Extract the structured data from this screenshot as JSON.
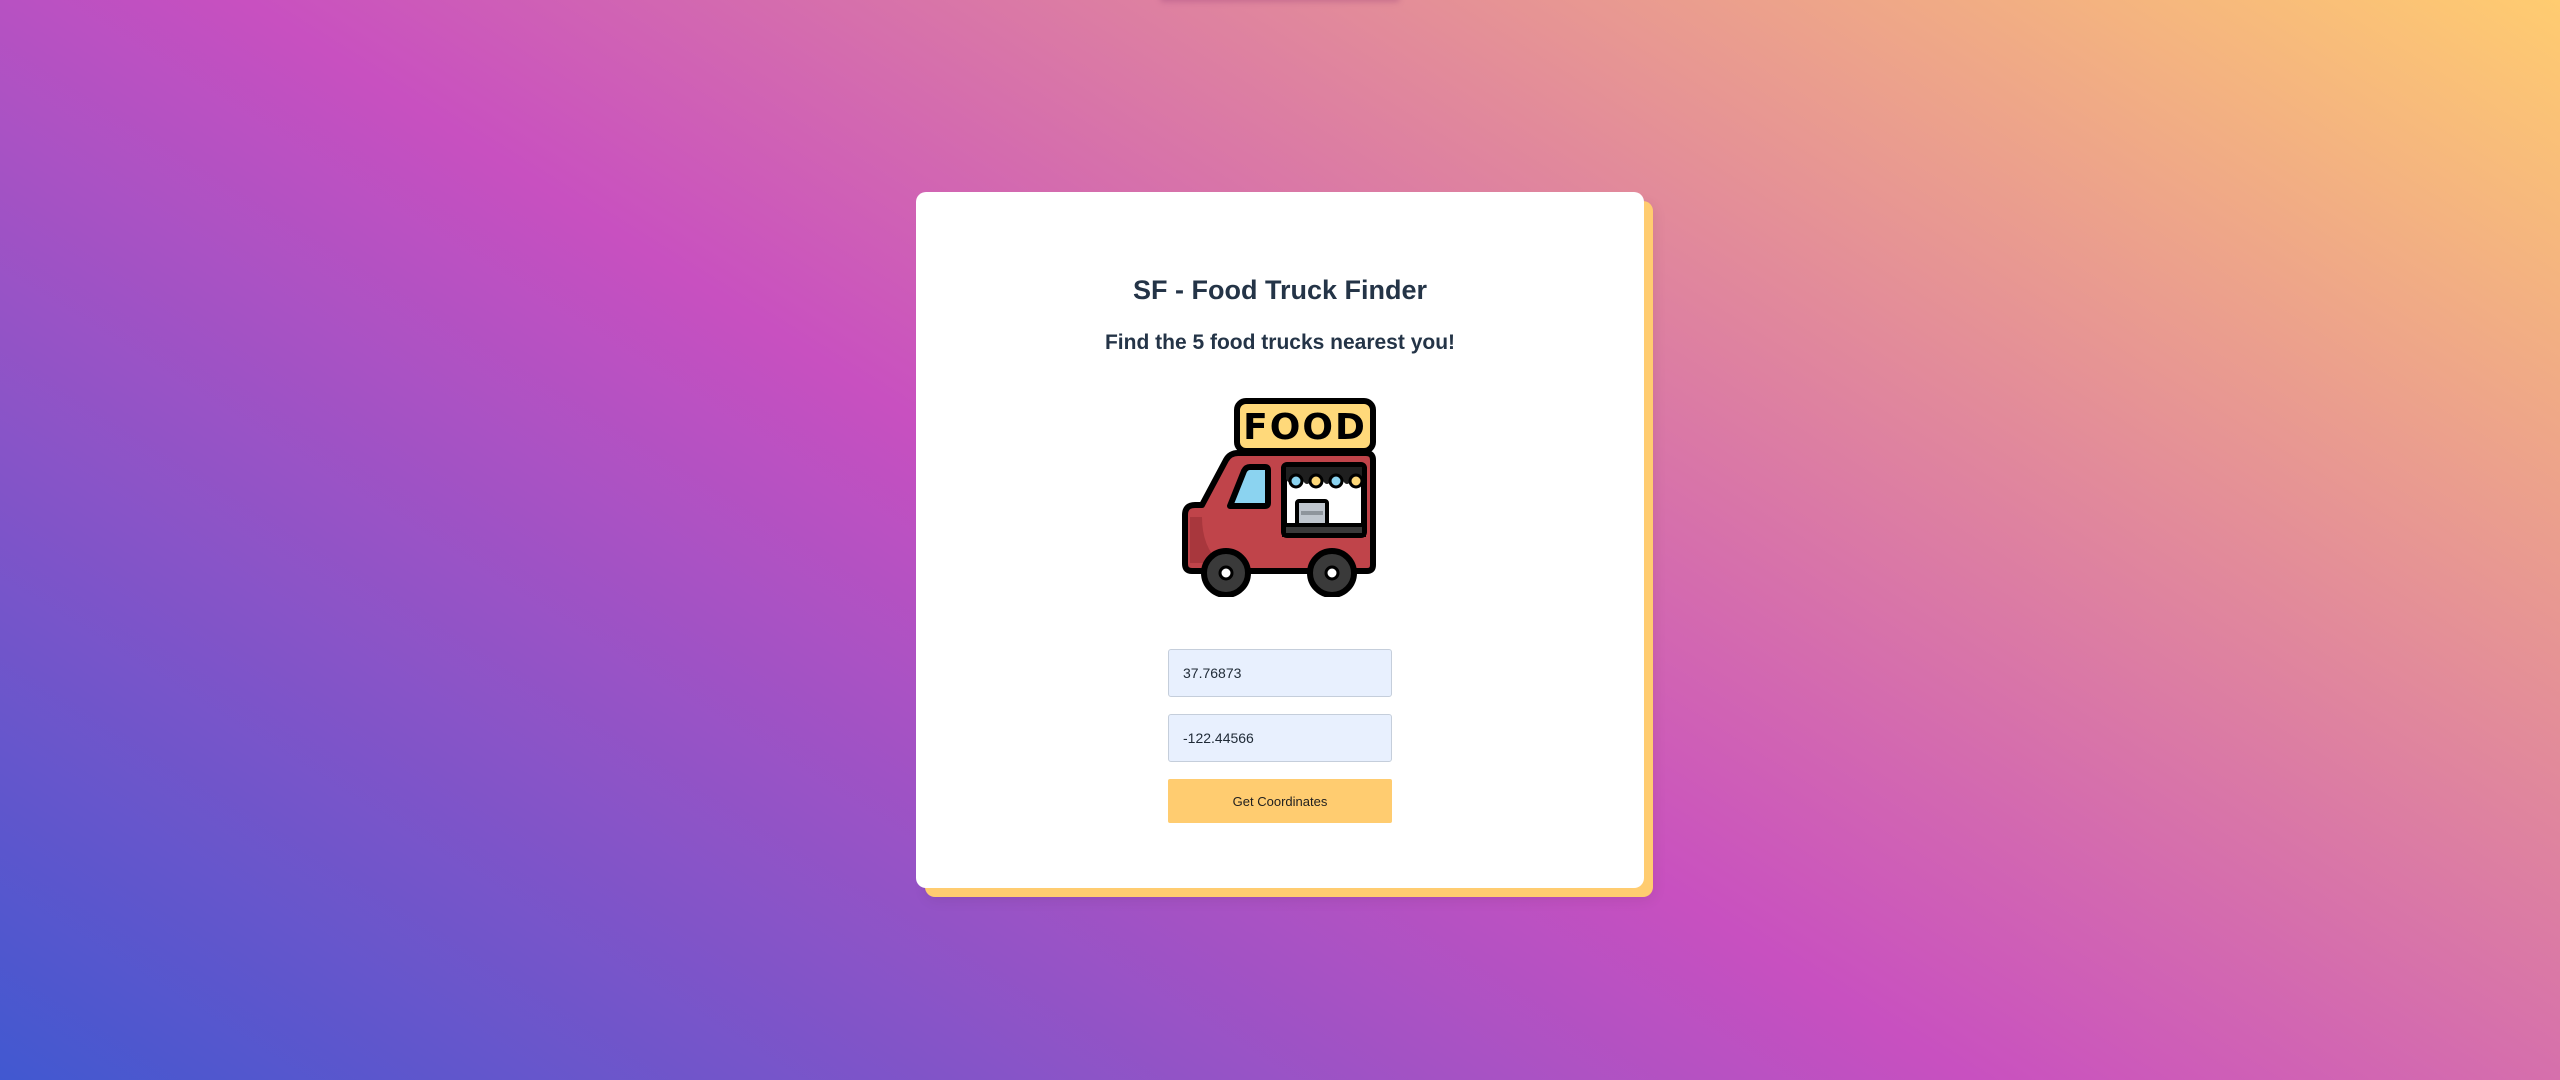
{
  "page": {
    "title": "SF - Food Truck Finder",
    "subtitle": "Find the 5 food trucks nearest you!"
  },
  "illustration": {
    "icon": "food-truck-icon",
    "sign_text": "FOOD"
  },
  "form": {
    "latitude_value": "37.76873",
    "longitude_value": "-122.44566",
    "submit_label": "Get Coordinates"
  },
  "colors": {
    "gradient_start": "#4158D0",
    "gradient_mid": "#C850C0",
    "gradient_end": "#FFCC70",
    "accent": "#FFCC70",
    "truck_body": "#C0444A",
    "sign": "#FFD97A",
    "window": "#8BD3F0"
  }
}
